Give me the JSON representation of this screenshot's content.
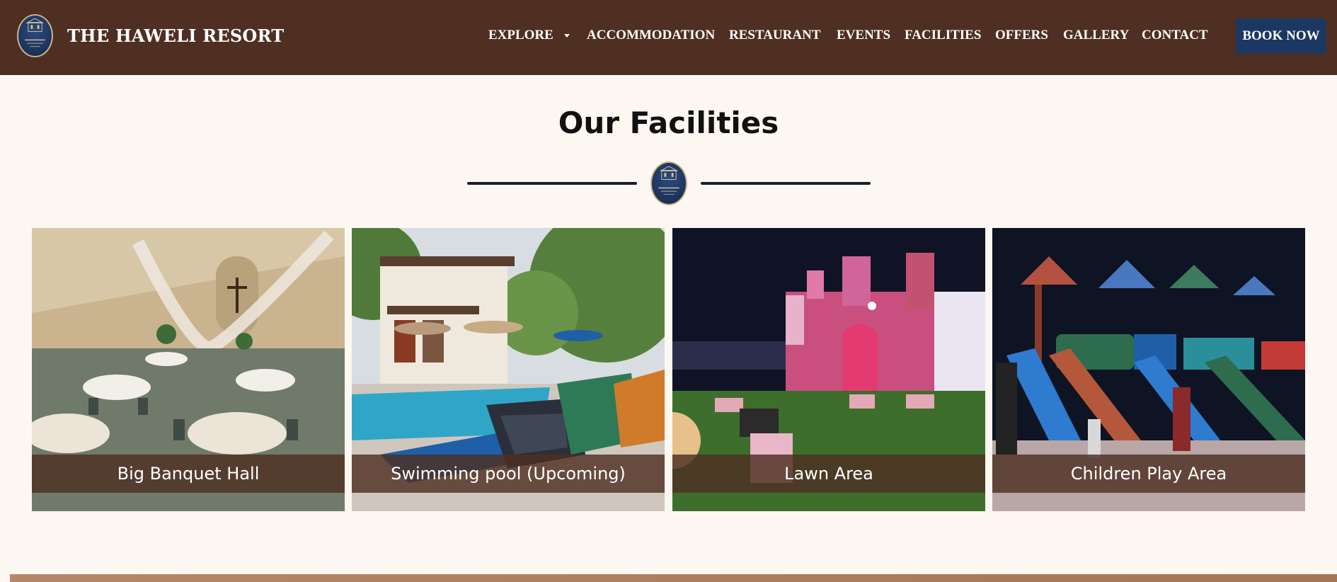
{
  "header": {
    "brand_name": "THE HAWELI RESORT",
    "logo_text": "The Haweli Resort",
    "background_color": "#4e2f22",
    "nav_items": [
      {
        "label": "EXPLORE",
        "has_dropdown": true
      },
      {
        "label": "ACCOMMODATION"
      },
      {
        "label": "RESTAURANT"
      },
      {
        "label": "EVENTS"
      },
      {
        "label": "FACILITIES"
      },
      {
        "label": "OFFERS"
      },
      {
        "label": "GALLERY"
      },
      {
        "label": "CONTACT"
      }
    ],
    "cta_label": "BOOK NOW",
    "cta_color": "#1c3862"
  },
  "main": {
    "title": "Our Facilities",
    "divider_logo_icon": "resort-emblem-icon",
    "facilities": [
      {
        "label": "Big Banquet Hall",
        "image": "banquet-hall-photo"
      },
      {
        "label": "Swimming pool (Upcoming)",
        "image": "swimming-pool-photo"
      },
      {
        "label": "Lawn Area",
        "image": "lawn-area-photo"
      },
      {
        "label": "Children Play Area",
        "image": "children-play-area-photo"
      }
    ]
  },
  "colors": {
    "page_background": "#fcf7f0",
    "caption_overlay": "#4e2f22",
    "footer_band": "#b5876a"
  }
}
